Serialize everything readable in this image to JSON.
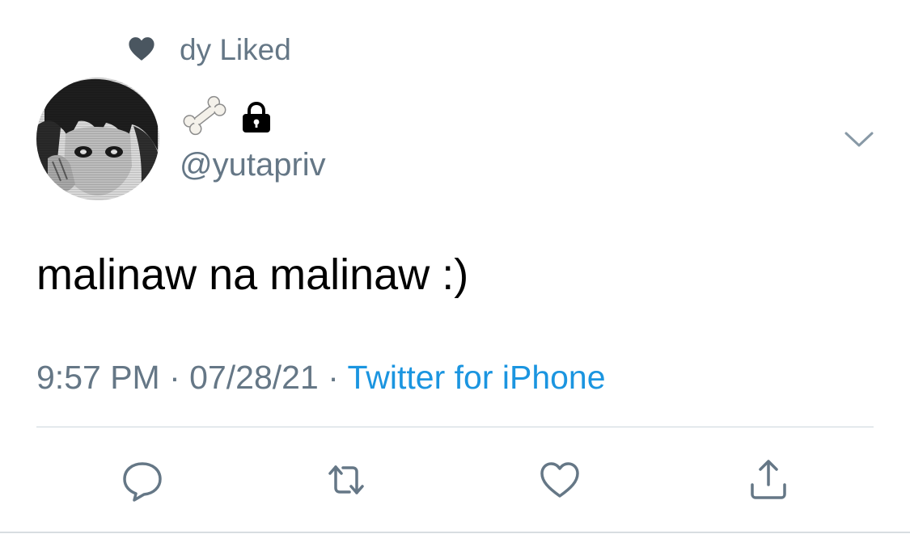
{
  "social_context": {
    "label": "dy Liked",
    "icon": "heart-filled-icon"
  },
  "author": {
    "display_name_icons": [
      "bone-icon",
      "lock-icon"
    ],
    "handle": "@yutapriv",
    "menu_icon": "chevron-down-icon"
  },
  "tweet": {
    "text": "malinaw na malinaw :)",
    "time": "9:57 PM",
    "separator": "·",
    "date": "07/28/21",
    "source": "Twitter for iPhone"
  },
  "actions": [
    {
      "name": "reply",
      "icon": "reply-icon"
    },
    {
      "name": "retweet",
      "icon": "retweet-icon"
    },
    {
      "name": "like",
      "icon": "heart-outline-icon"
    },
    {
      "name": "share",
      "icon": "share-icon"
    }
  ],
  "colors": {
    "secondary_text": "#657786",
    "link": "#1b95e0",
    "primary_text": "#000000",
    "divider": "#ccd6dd"
  }
}
